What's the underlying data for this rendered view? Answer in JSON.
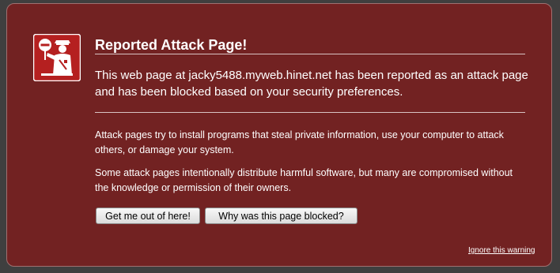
{
  "dialog": {
    "title": "Reported Attack Page!",
    "lead": "This web page at jacky5488.myweb.hinet.net has been reported as an attack page and has been blocked based on your security preferences.",
    "paragraph_1": "Attack pages try to install programs that steal private information, use your computer to attack others, or damage your system.",
    "paragraph_2": "Some attack pages intentionally distribute harmful software, but many are compromised without the knowledge or permission of their owners.",
    "get_me_out_label": "Get me out of here!",
    "why_blocked_label": "Why was this page blocked?",
    "ignore_label": "Ignore this warning",
    "icon": "police-officer-stop-icon"
  },
  "colors": {
    "panel_background": "#722222",
    "icon_background": "#b52020",
    "text": "#ffffff"
  }
}
